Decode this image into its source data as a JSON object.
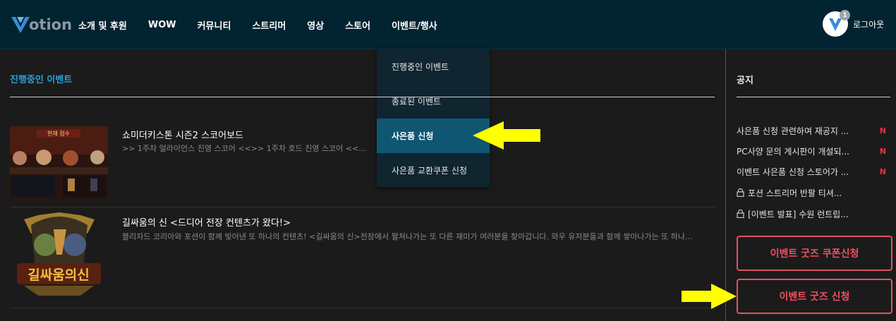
{
  "header": {
    "logo_text": "otion",
    "nav": [
      "소개 및 후원",
      "WOW",
      "커뮤니티",
      "스트리머",
      "영상",
      "스토어",
      "이벤트/행사"
    ],
    "avatar_badge": "1",
    "logout_label": "로그아웃"
  },
  "dropdown": {
    "items": [
      "진행중인 이벤트",
      "종료된 이벤트",
      "사은품 신청",
      "사은품 교환쿠폰 신청"
    ],
    "active_index": 2
  },
  "main": {
    "section_title": "진행중인 이벤트",
    "events": [
      {
        "title": "쇼미더키스톤 시즌2 스코어보드",
        "desc": ">> 1주차 얼라이언스 진영 스코어 <<>> 1주차 호드 진영 스코어 <<..."
      },
      {
        "title": "길싸움의 신 <드디어 전장 컨텐츠가 왔다!>",
        "desc": "블리자드 코리아와 포션이 함께 빚어낸 또 하나의 컨텐츠! <길싸움의 신>전장에서 펼쳐나가는 또 다른 재미가 여러분을 찾아갑니다. 와우 유저분들과 함께 쌓아나가는 또 하나..."
      }
    ],
    "thumb1_header": "현재 점수",
    "thumb2_logo": "길싸움의신"
  },
  "sidebar": {
    "title": "공지",
    "notices": [
      {
        "text": "사은품 신청 관련하여 재공지 ...",
        "new": "N",
        "locked": false
      },
      {
        "text": "PC사양 문의 게시판이 개설되...",
        "new": "N",
        "locked": false
      },
      {
        "text": "이벤트 사은품 신청 스토어가 ...",
        "new": "N",
        "locked": false
      },
      {
        "text": "포션 스트리머 반팔 티셔...",
        "new": "",
        "locked": true
      },
      {
        "text": "[이벤트 발표] 수원 런트립...",
        "new": "",
        "locked": true
      }
    ],
    "buttons": [
      "이벤트 굿즈 쿠폰신청",
      "이벤트 굿즈 신청"
    ]
  },
  "colors": {
    "header_bg": "#022330",
    "accent_blue": "#2a9fd8",
    "dropdown_active": "#0f5673",
    "button_red": "#e05260",
    "arrow_yellow": "#ffff00"
  },
  "icons": [
    "potion-logo-icon",
    "user-avatar-icon",
    "lock-icon",
    "arrow-pointer-icon"
  ]
}
